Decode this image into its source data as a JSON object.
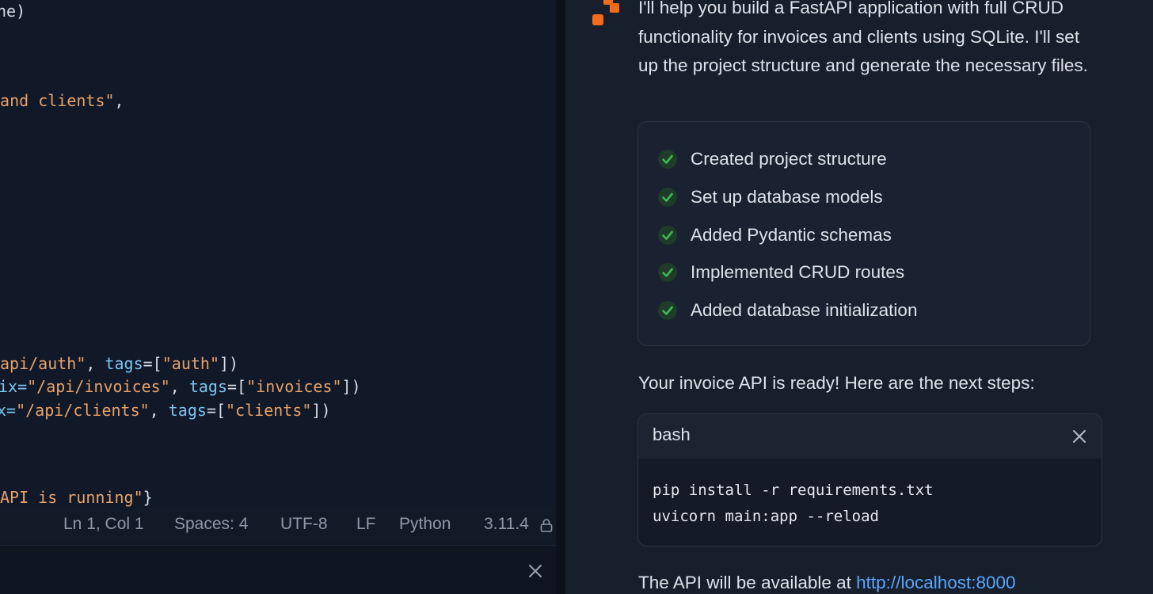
{
  "editor": {
    "code_lines": [
      [
        {
          "t": "ne)",
          "c": "tok-p"
        }
      ],
      [
        {
          "t": " and clients\"",
          "c": "tok-str"
        },
        {
          "t": ",",
          "c": "tok-p"
        }
      ],
      [
        {
          "t": "api/auth\"",
          "c": "tok-str"
        },
        {
          "t": ", ",
          "c": "tok-p"
        },
        {
          "t": "tags",
          "c": "tok-kw"
        },
        {
          "t": "=[",
          "c": "tok-p"
        },
        {
          "t": "\"auth\"",
          "c": "tok-str"
        },
        {
          "t": "])",
          "c": "tok-p"
        }
      ],
      [
        {
          "t": "ix=",
          "c": "tok-kw"
        },
        {
          "t": "\"/api/invoices\"",
          "c": "tok-str"
        },
        {
          "t": ", ",
          "c": "tok-p"
        },
        {
          "t": "tags",
          "c": "tok-kw"
        },
        {
          "t": "=[",
          "c": "tok-p"
        },
        {
          "t": "\"invoices\"",
          "c": "tok-str"
        },
        {
          "t": "])",
          "c": "tok-p"
        }
      ],
      [
        {
          "t": "x=",
          "c": "tok-kw"
        },
        {
          "t": "\"/api/clients\"",
          "c": "tok-str"
        },
        {
          "t": ", ",
          "c": "tok-p"
        },
        {
          "t": "tags",
          "c": "tok-kw"
        },
        {
          "t": "=[",
          "c": "tok-p"
        },
        {
          "t": "\"clients\"",
          "c": "tok-str"
        },
        {
          "t": "])",
          "c": "tok-p"
        }
      ],
      [
        {
          "t": "API is running\"",
          "c": "tok-str"
        },
        {
          "t": "}",
          "c": "tok-p"
        }
      ]
    ],
    "status": {
      "position": "Ln 1, Col 1",
      "spaces": "Spaces: 4",
      "encoding": "UTF-8",
      "eol": "LF",
      "language": "Python",
      "version": "3.11.4"
    }
  },
  "chat": {
    "intro": "I'll help you build a FastAPI application with full CRUD functionality for invoices and clients using SQLite. I'll set up the project structure and generate the necessary files.",
    "tasks": [
      "Created project structure",
      "Set up database models",
      "Added Pydantic schemas",
      "Implemented CRUD routes",
      "Added database initialization"
    ],
    "ready_text": "Your invoice API is ready! Here are the next steps:",
    "code_block": {
      "lang": "bash",
      "lines": [
        "pip install -r requirements.txt",
        "uvicorn main:app --reload"
      ]
    },
    "available_prefix": "The API will be available at ",
    "available_link": "http://localhost:8000"
  },
  "colors": {
    "accent_orange": "#f26a1b",
    "check_green": "#3fb950",
    "link_blue": "#58a6ff"
  }
}
